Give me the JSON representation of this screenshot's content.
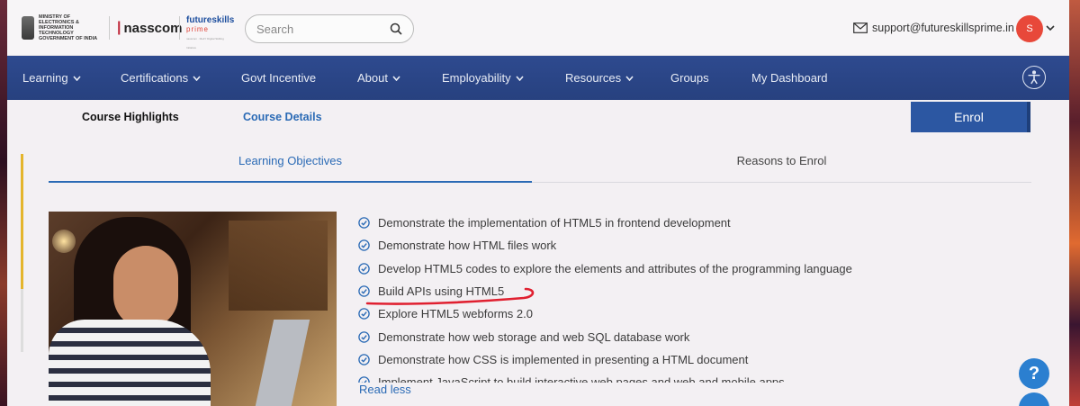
{
  "header": {
    "ministry_lines": [
      "MINISTRY OF",
      "ELECTRONICS &",
      "INFORMATION TECHNOLOGY",
      "GOVERNMENT OF INDIA"
    ],
    "nasscom": "nasscom",
    "fsp": {
      "line1": "futureskills",
      "line2": "prime",
      "tagline": "nasscom · MeitY Digital Skilling Initiative"
    },
    "search_placeholder": "Search",
    "support_email": "support@futureskillsprime.in",
    "avatar_initial": "S"
  },
  "nav": {
    "items": [
      {
        "label": "Learning",
        "dropdown": true
      },
      {
        "label": "Certifications",
        "dropdown": true
      },
      {
        "label": "Govt Incentive",
        "dropdown": false
      },
      {
        "label": "About",
        "dropdown": true
      },
      {
        "label": "Employability",
        "dropdown": true
      },
      {
        "label": "Resources",
        "dropdown": true
      },
      {
        "label": "Groups",
        "dropdown": false
      },
      {
        "label": "My Dashboard",
        "dropdown": false
      }
    ]
  },
  "course": {
    "tab_highlights": "Course Highlights",
    "tab_details": "Course Details",
    "enrol": "Enrol",
    "sub_tabs": [
      "Learning Objectives",
      "Reasons to Enrol"
    ],
    "objectives": [
      "Demonstrate the implementation of HTML5 in frontend development",
      "Demonstrate how HTML files work",
      "Develop HTML5 codes to explore the elements and attributes of the programming language",
      "Build APIs using HTML5",
      "Explore HTML5 webforms 2.0",
      "Demonstrate how web storage and web SQL database work",
      "Demonstrate how CSS is implemented in presenting a HTML document",
      "Implement JavaScript to build interactive web pages and web and mobile apps"
    ],
    "read_less": "Read less"
  },
  "floating": {
    "help": "?"
  },
  "colors": {
    "nav_bg": "#2e4a8f",
    "accent_blue": "#2a6ab5",
    "enrol_bg": "#2c57a2",
    "avatar_bg": "#e8483a",
    "scroll_yellow": "#e4b52c",
    "annotation_red": "#e02030"
  }
}
